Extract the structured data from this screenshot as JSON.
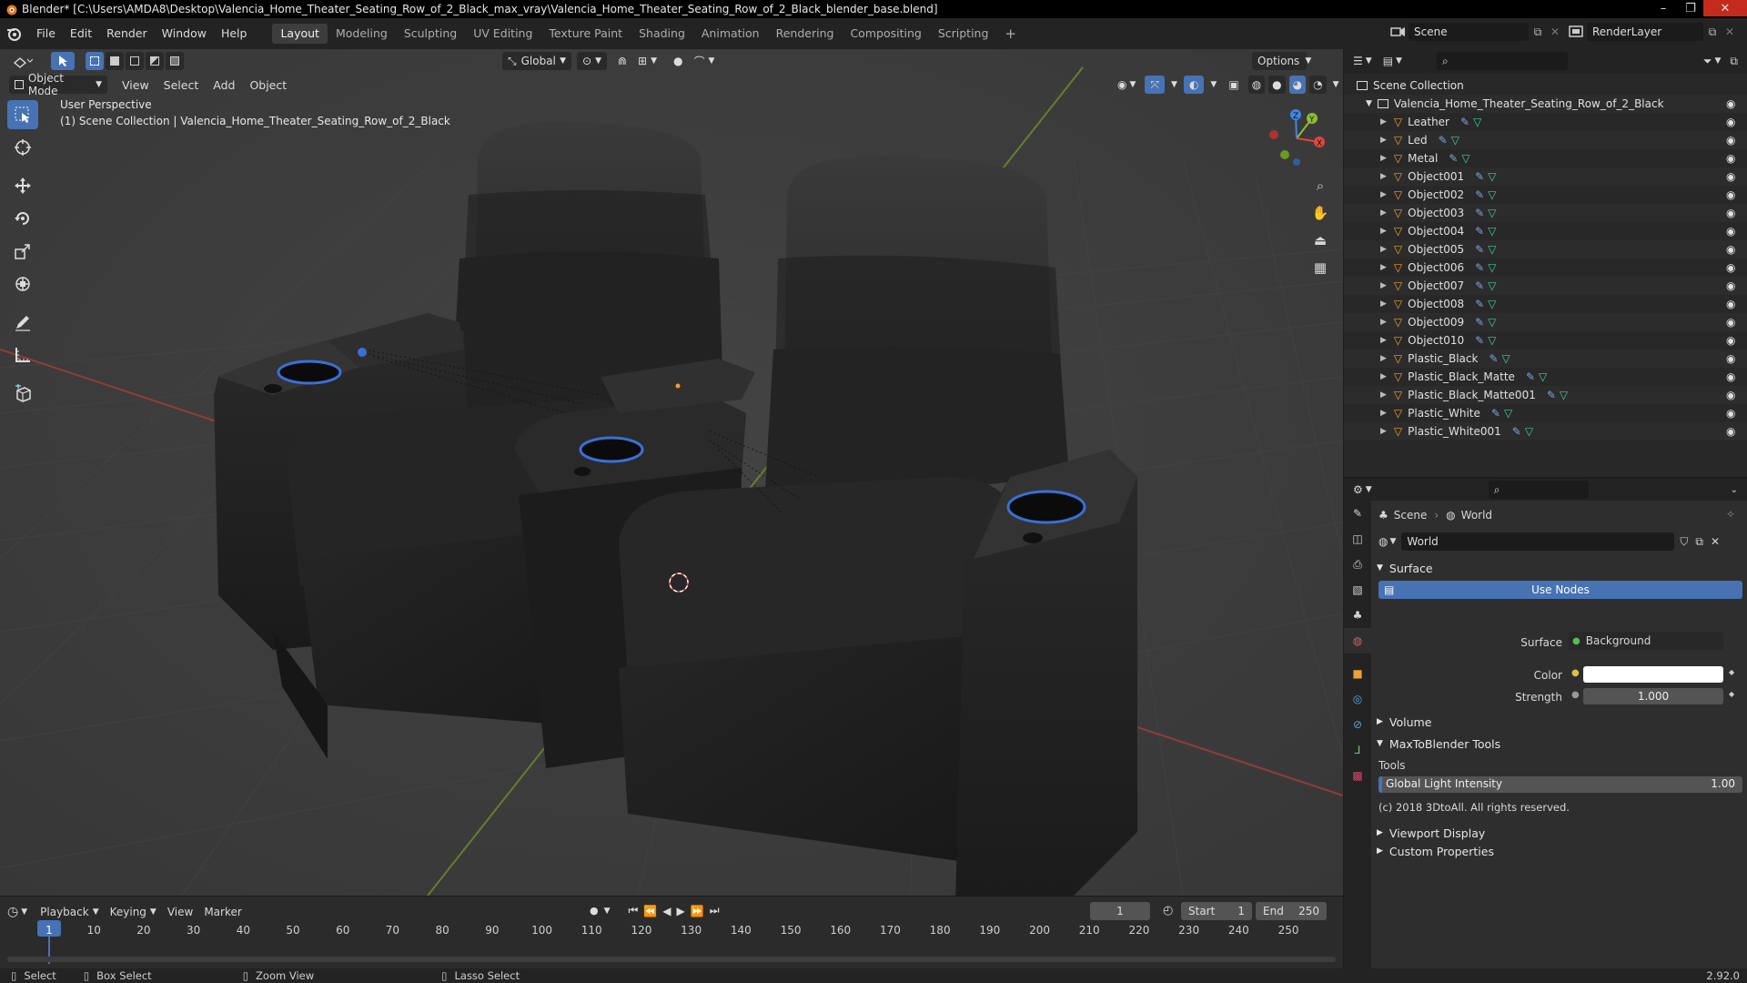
{
  "window": {
    "title": "Blender* [C:\\Users\\AMDA8\\Desktop\\Valencia_Home_Theater_Seating_Row_of_2_Black_max_vray\\Valencia_Home_Theater_Seating_Row_of_2_Black_blender_base.blend]"
  },
  "menu": [
    "File",
    "Edit",
    "Render",
    "Window",
    "Help"
  ],
  "workspaces": [
    "Layout",
    "Modeling",
    "Sculpting",
    "UV Editing",
    "Texture Paint",
    "Shading",
    "Animation",
    "Rendering",
    "Compositing",
    "Scripting"
  ],
  "scene_name": "Scene",
  "view_layer": "RenderLayer",
  "viewport": {
    "transform_orientation": "Global",
    "options_label": "Options",
    "mode": "Object Mode",
    "header_menu": [
      "View",
      "Select",
      "Add",
      "Object"
    ],
    "info_line1": "User Perspective",
    "info_line2": "(1) Scene Collection | Valencia_Home_Theater_Seating_Row_of_2_Black",
    "gizmo_axes": {
      "x": "X",
      "y": "Y",
      "z": "Z"
    }
  },
  "outliner": {
    "root": "Scene Collection",
    "collection": "Valencia_Home_Theater_Seating_Row_of_2_Black",
    "objects": [
      "Leather",
      "Led",
      "Metal",
      "Object001",
      "Object002",
      "Object003",
      "Object004",
      "Object005",
      "Object006",
      "Object007",
      "Object008",
      "Object009",
      "Object010",
      "Plastic_Black",
      "Plastic_Black_Matte",
      "Plastic_Black_Matte001",
      "Plastic_White",
      "Plastic_White001"
    ]
  },
  "properties": {
    "breadcrumb_scene": "Scene",
    "breadcrumb_world": "World",
    "world_name": "World",
    "surface_panel": "Surface",
    "use_nodes": "Use Nodes",
    "surface_label": "Surface",
    "surface_value": "Background",
    "color_label": "Color",
    "color_value": "#ffffff",
    "strength_label": "Strength",
    "strength_value": "1.000",
    "volume_panel": "Volume",
    "max_panel": "MaxToBlender Tools",
    "tools_label": "Tools",
    "gli_label": "Global Light Intensity",
    "gli_value": "1.00",
    "copyright": "(c) 2018 3DtoAll. All rights reserved.",
    "viewport_display": "Viewport Display",
    "custom_properties": "Custom Properties"
  },
  "timeline": {
    "menu": [
      "Playback",
      "Keying",
      "View",
      "Marker"
    ],
    "current_frame": "1",
    "start_label": "Start",
    "start_value": "1",
    "end_label": "End",
    "end_value": "250",
    "ticks": [
      "1",
      "10",
      "20",
      "30",
      "40",
      "50",
      "60",
      "70",
      "80",
      "90",
      "100",
      "110",
      "120",
      "130",
      "140",
      "150",
      "160",
      "170",
      "180",
      "190",
      "200",
      "210",
      "220",
      "230",
      "240",
      "250"
    ]
  },
  "statusbar": {
    "select": "Select",
    "box_select": "Box Select",
    "zoom_view": "Zoom View",
    "lasso_select": "Lasso Select",
    "version": "2.92.0"
  },
  "colors": {
    "accent": "#4772b3",
    "viewport_bg": "#3b3b3b",
    "axis_x": "#e2463c",
    "axis_y": "#8cbf2b",
    "axis_z": "#3d87e5"
  }
}
